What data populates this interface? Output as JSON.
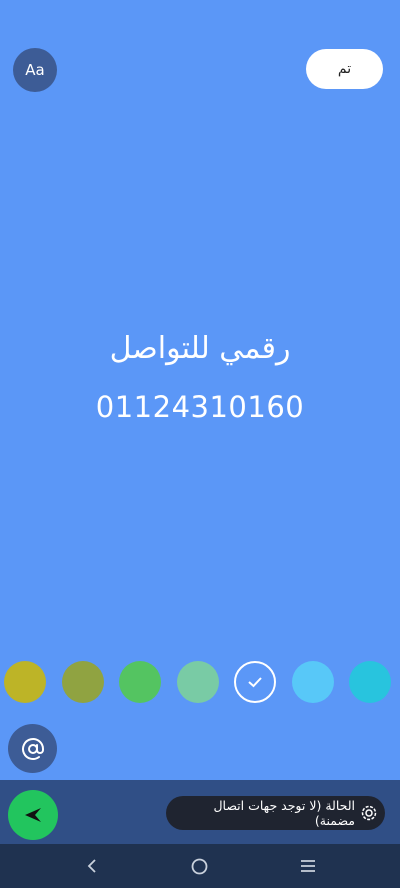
{
  "header": {
    "font_button_label": "Aa",
    "done_button_label": "تم"
  },
  "status": {
    "line1": "رقمي للتواصل",
    "line2": "01124310160",
    "background_color": "#5b97f7"
  },
  "color_palette": {
    "swatches": [
      "#bdb427",
      "#90a341",
      "#54c461",
      "#79cba5",
      "#5b97f7",
      "#58c8f8",
      "#28c4de"
    ],
    "selected_index": 4
  },
  "mention_icon": "at-icon",
  "audience": {
    "label": "الحالة (لا توجد جهات اتصال مضمنة)",
    "icon": "status-ring-icon"
  },
  "send_button": {
    "icon": "send-arrow-icon",
    "color": "#22c55e"
  },
  "navigation": {
    "back_icon": "back-chevron-icon",
    "home_icon": "home-circle-icon",
    "recents_icon": "recents-lines-icon"
  }
}
